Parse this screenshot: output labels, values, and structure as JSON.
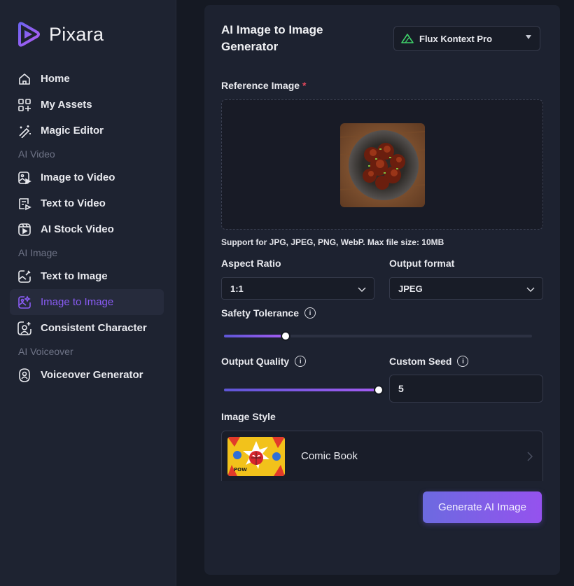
{
  "app": {
    "name": "Pixara"
  },
  "sidebar": {
    "items": [
      {
        "type": "item",
        "label": "Home",
        "icon": "home-icon"
      },
      {
        "type": "item",
        "label": "My Assets",
        "icon": "assets-icon"
      },
      {
        "type": "item",
        "label": "Magic Editor",
        "icon": "magic-wand-icon"
      },
      {
        "type": "section",
        "label": "AI Video"
      },
      {
        "type": "item",
        "label": "Image to Video",
        "icon": "image-to-video-icon"
      },
      {
        "type": "item",
        "label": "Text to Video",
        "icon": "text-to-video-icon"
      },
      {
        "type": "item",
        "label": "AI Stock Video",
        "icon": "stock-video-icon"
      },
      {
        "type": "section",
        "label": "AI Image"
      },
      {
        "type": "item",
        "label": "Text to Image",
        "icon": "text-to-image-icon"
      },
      {
        "type": "item",
        "label": "Image to Image",
        "icon": "image-to-image-icon",
        "active": true
      },
      {
        "type": "item",
        "label": "Consistent Character",
        "icon": "consistent-character-icon"
      },
      {
        "type": "section",
        "label": "AI Voiceover"
      },
      {
        "type": "item",
        "label": "Voiceover Generator",
        "icon": "voiceover-icon"
      }
    ]
  },
  "main": {
    "title": "AI Image to Image Generator",
    "model": {
      "label": "Flux Kontext Pro",
      "icon": "flux-logo-icon"
    },
    "reference_image": {
      "label": "Reference Image",
      "required_mark": "*"
    },
    "support_text": "Support for JPG, JPEG, PNG, WebP. Max file size: 10MB",
    "aspect_ratio": {
      "label": "Aspect Ratio",
      "value": "1:1"
    },
    "output_format": {
      "label": "Output format",
      "value": "JPEG"
    },
    "safety_tolerance": {
      "label": "Safety Tolerance",
      "fraction": 0.2
    },
    "output_quality": {
      "label": "Output Quality",
      "fraction": 1.0
    },
    "custom_seed": {
      "label": "Custom Seed",
      "value": "5"
    },
    "image_style": {
      "label": "Image Style",
      "value": "Comic Book"
    },
    "generate_label": "Generate AI Image"
  },
  "colors": {
    "accent": "#8a5cf6",
    "required": "#e0475b",
    "panel": "#1d2230",
    "sidebar": "#1e2331"
  }
}
